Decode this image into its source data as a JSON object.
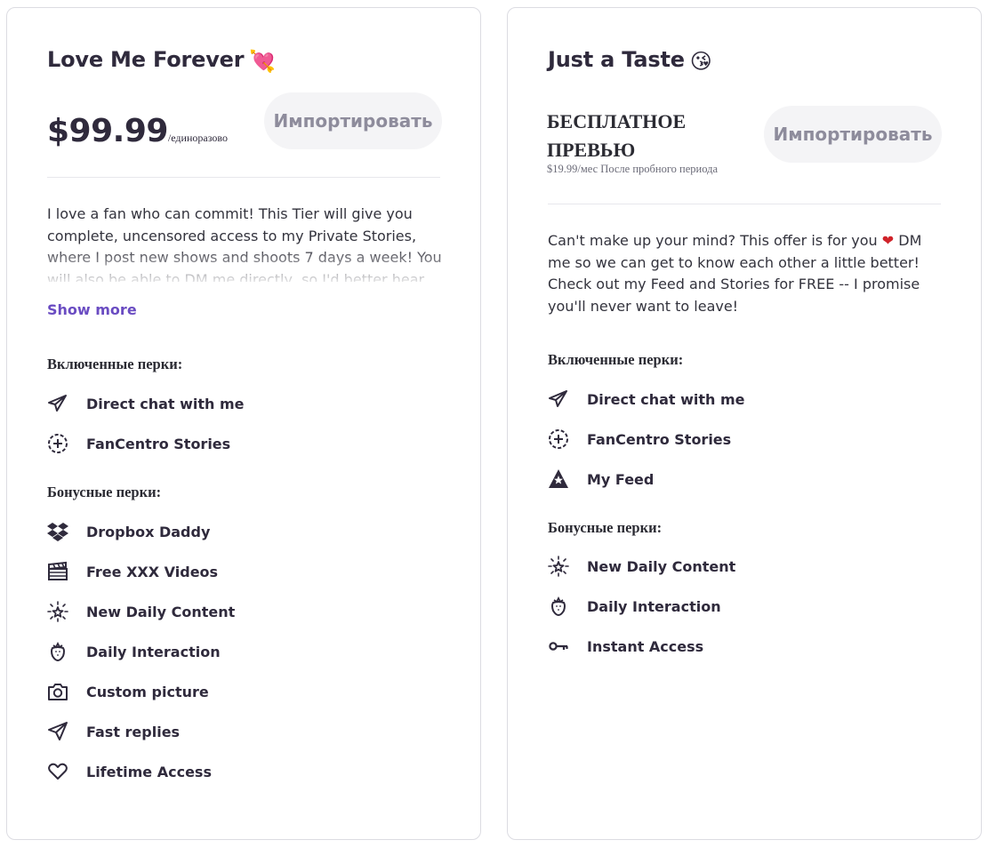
{
  "cards": [
    {
      "title": "Love Me Forever",
      "title_emoji": "💘",
      "price": "$99.99",
      "price_suffix": "/единоразово",
      "import_label": "Импортировать",
      "description": "I love a fan who can commit! This Tier will give you complete, uncensored access to my Private Stories, where I post new shows and shoots 7 days a week! You will also be able to DM me directly, so I'd better hear",
      "show_more": "Show more",
      "included_heading": "Включенные перки:",
      "included": [
        {
          "icon": "paper-plane-icon",
          "label": "Direct chat with me"
        },
        {
          "icon": "stories-plus-icon",
          "label": "FanCentro Stories"
        }
      ],
      "bonus_heading": "Бонусные перки:",
      "bonus": [
        {
          "icon": "dropbox-icon",
          "label": "Dropbox Daddy"
        },
        {
          "icon": "clapperboard-icon",
          "label": "Free XXX Videos"
        },
        {
          "icon": "sparkle-star-icon",
          "label": "New Daily Content"
        },
        {
          "icon": "strawberry-icon",
          "label": "Daily Interaction"
        },
        {
          "icon": "camera-icon",
          "label": "Custom picture"
        },
        {
          "icon": "send-icon",
          "label": "Fast replies"
        },
        {
          "icon": "heart-icon",
          "label": "Lifetime Access"
        }
      ]
    },
    {
      "title": "Just a Taste",
      "title_emoji": "😘",
      "free_label": "БЕСПЛАТНОЕ ПРЕВЬЮ",
      "free_sub": "$19.99/мес После пробного периода",
      "import_label": "Импортировать",
      "description_before": "Can't make up your mind? This offer is for you ",
      "description_heart": "❤",
      "description_after": " DM me so we can get to know each other a little better! Check out my Feed and Stories for FREE -- I promise you'll never want to leave!",
      "included_heading": "Включенные перки:",
      "included": [
        {
          "icon": "paper-plane-icon",
          "label": "Direct chat with me"
        },
        {
          "icon": "stories-plus-icon",
          "label": "FanCentro Stories"
        },
        {
          "icon": "feed-icon",
          "label": "My Feed"
        }
      ],
      "bonus_heading": "Бонусные перки:",
      "bonus": [
        {
          "icon": "sparkle-star-icon",
          "label": "New Daily Content"
        },
        {
          "icon": "strawberry-icon",
          "label": "Daily Interaction"
        },
        {
          "icon": "key-icon",
          "label": "Instant Access"
        }
      ]
    }
  ]
}
